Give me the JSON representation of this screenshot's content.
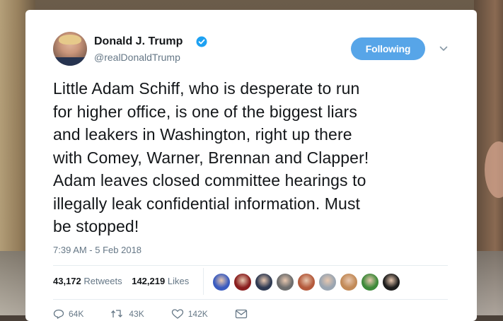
{
  "tweet": {
    "author": {
      "display_name": "Donald J. Trump",
      "handle": "@realDonaldTrump",
      "verified": true
    },
    "follow_button_label": "Following",
    "text_lines": [
      "Little Adam Schiff, who is desperate to run",
      "for higher office, is one of the biggest liars",
      "and leakers in Washington, right up there",
      "with Comey, Warner, Brennan and Clapper!",
      "Adam leaves closed committee hearings to",
      "illegally leak confidential information. Must",
      "be stopped!"
    ],
    "timestamp": "7:39 AM - 5 Feb 2018",
    "stats": {
      "retweets_count": "43,172",
      "retweets_label": "Retweets",
      "likes_count": "142,219",
      "likes_label": "Likes"
    },
    "liker_avatar_colors": [
      "#3a5bbf",
      "#8a1f1f",
      "#2f3a52",
      "#6d6d6d",
      "#b45a3c",
      "#9aa5b1",
      "#c28a58",
      "#3e8a3a",
      "#1d1d1d"
    ],
    "actions": {
      "reply_count": "64K",
      "retweet_count": "43K",
      "like_count": "142K"
    },
    "colors": {
      "accent": "#57a5e8",
      "text": "#14171a",
      "secondary": "#657786"
    }
  }
}
